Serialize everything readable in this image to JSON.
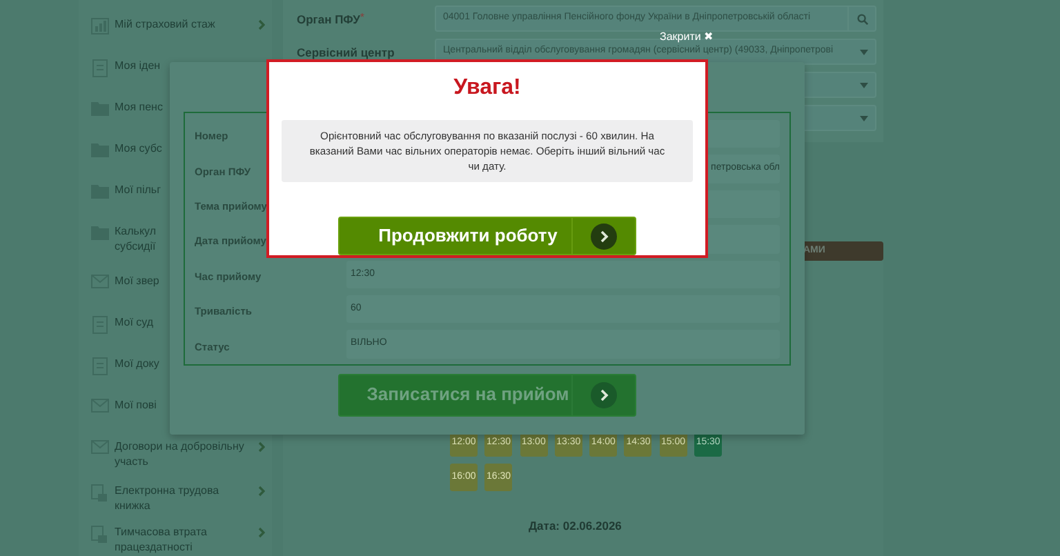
{
  "sidebar": {
    "items": [
      {
        "label": "Мій страховий стаж",
        "kind": "chart",
        "chevron": true
      },
      {
        "label": "Моя іден",
        "kind": "doc",
        "chevron": false
      },
      {
        "label": "Моя пенс",
        "kind": "folder",
        "chevron": false
      },
      {
        "label": "Моя субс",
        "kind": "folder",
        "chevron": false
      },
      {
        "label": "Мої пільг",
        "kind": "folder",
        "chevron": false
      },
      {
        "label": "Калькул субсидії",
        "kind": "folder",
        "chevron": false
      },
      {
        "label": "Мої звер",
        "kind": "mail",
        "chevron": false
      },
      {
        "label": "Мої суд",
        "kind": "doc",
        "chevron": false
      },
      {
        "label": "Мої доку",
        "kind": "doc",
        "chevron": false
      },
      {
        "label": "Мої пові",
        "kind": "mail",
        "chevron": false
      },
      {
        "label": "Договори на добровільну участь",
        "kind": "mail",
        "chevron": true
      },
      {
        "label": "Електронна трудова книжка",
        "kind": "book",
        "chevron": true
      },
      {
        "label": "Тимчасова втрата працездатності",
        "kind": "book",
        "chevron": true
      }
    ]
  },
  "form": {
    "fields": [
      {
        "label": "Орган ПФУ",
        "required_mark": "*",
        "kind": "search",
        "value": "04001 Головне управління Пенсійного фонду України в Дніпропетровській області"
      },
      {
        "label": "Сервісний центр",
        "kind": "select",
        "value": "Центральний відділ обслуговування громадян (сервісний центр) (49033, Дніпропетрові"
      },
      {
        "kind": "select"
      },
      {
        "kind": "select"
      }
    ]
  },
  "partial_button": {
    "label": "АМИ"
  },
  "time_slots": [
    {
      "label": "12:00",
      "selected": false
    },
    {
      "label": "12:30",
      "selected": false
    },
    {
      "label": "13:00",
      "selected": false
    },
    {
      "label": "13:30",
      "selected": false
    },
    {
      "label": "14:00",
      "selected": false
    },
    {
      "label": "14:30",
      "selected": false
    },
    {
      "label": "15:00",
      "selected": false
    },
    {
      "label": "15:30",
      "selected": true
    },
    {
      "label": "16:00",
      "selected": false
    },
    {
      "label": "16:30",
      "selected": false
    }
  ],
  "date_heading": "Дата: 02.06.2026",
  "appointment_dialog": {
    "rows": [
      {
        "label": "Номер"
      },
      {
        "label": "Орган ПФУ",
        "value": "петровська обл",
        "clipped": true
      },
      {
        "label": "Тема прийому"
      },
      {
        "label": "Дата прийому"
      },
      {
        "label": "Час прийому",
        "value": "12:30"
      },
      {
        "label": "Тривалість",
        "value": "60"
      },
      {
        "label": "Статус",
        "value": "ВІЛЬНО"
      }
    ],
    "button": "Записатися на прийом"
  },
  "alert": {
    "close_label": "Закрити",
    "close_icon": "✖",
    "title": "Увага!",
    "message": "Орієнтовний час обслуговування по вказаній послузі - 60 хвилин. На вказаний Вами час вільних операторів немає. Оберіть інший вільний час чи дату.",
    "button": "Продовжити роботу"
  }
}
